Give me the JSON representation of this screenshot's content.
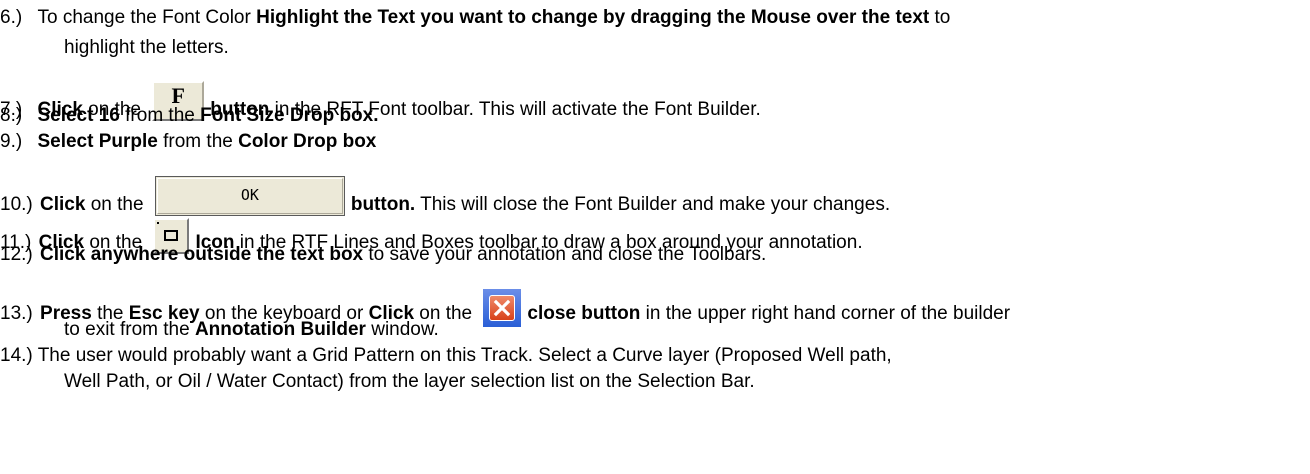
{
  "steps": [
    {
      "num": "6.)",
      "t1": "To change the Font Color ",
      "b1": "Highlight the Text you want to change by dragging the Mouse over the text",
      "t2": " to",
      "cont": "highlight the letters."
    },
    {
      "num": "7.)",
      "b1": "Click",
      "t1": " on the",
      "btn": "F",
      "b2": "button",
      "t2": " in the RFT Font toolbar. This will activate the Font Builder."
    },
    {
      "num": "8.)",
      "b1": "Select 16",
      "t1": " from the ",
      "b2": "Font Size Drop box."
    },
    {
      "num": "9.)",
      "b1": "Select Purple",
      "t1": " from the ",
      "b2": "Color Drop box"
    },
    {
      "num": "10.)",
      "b1": "Click",
      "t1": " on the",
      "btn": "OK",
      "b2": "button.",
      "t2": " This will close the Font Builder and make your changes."
    },
    {
      "num": "11.)",
      "b1": "Click",
      "t1": " on the",
      "b2": "Icon",
      "t2": " in the RTF Lines and Boxes toolbar to draw a box around your annotation."
    },
    {
      "num": "12.)",
      "b1": "Click anywhere outside the text box",
      "t1": " to save your annotation and close the Toolbars."
    },
    {
      "num": "13.)",
      "b1": "Press",
      "t1": " the ",
      "b2": "Esc key",
      "t2": " on the keyboard or ",
      "b3": "Click",
      "t3": " on the",
      "b4": "close button",
      "t4": " in the upper right hand corner of the builder",
      "cont_t1": "to exit from the ",
      "cont_b1": "Annotation Builder",
      "cont_t2": " window."
    },
    {
      "num": "14.)",
      "t1": "The user would probably want a Grid Pattern on this Track. Select a Curve layer (Proposed Well path,",
      "cont": "Well Path, or Oil / Water Contact) from the layer selection list on the Selection Bar."
    }
  ]
}
